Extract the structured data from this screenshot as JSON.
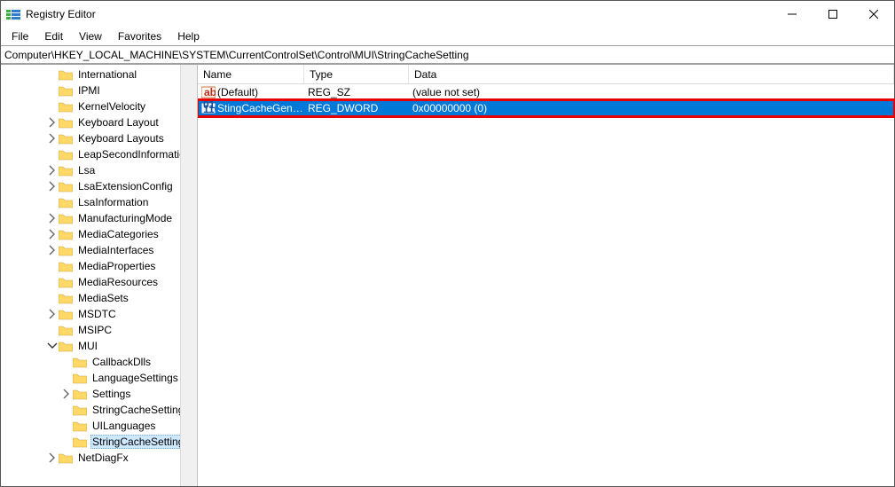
{
  "titlebar": {
    "title": "Registry Editor"
  },
  "menubar": {
    "file": "File",
    "edit": "Edit",
    "view": "View",
    "favorites": "Favorites",
    "help": "Help"
  },
  "addressbar": {
    "path": "Computer\\HKEY_LOCAL_MACHINE\\SYSTEM\\CurrentControlSet\\Control\\MUI\\StringCacheSetting"
  },
  "tree": {
    "items": [
      {
        "depth": 3,
        "twisty": "none",
        "label": "International"
      },
      {
        "depth": 3,
        "twisty": "none",
        "label": "IPMI"
      },
      {
        "depth": 3,
        "twisty": "none",
        "label": "KernelVelocity"
      },
      {
        "depth": 3,
        "twisty": "closed",
        "label": "Keyboard Layout"
      },
      {
        "depth": 3,
        "twisty": "closed",
        "label": "Keyboard Layouts"
      },
      {
        "depth": 3,
        "twisty": "none",
        "label": "LeapSecondInformation"
      },
      {
        "depth": 3,
        "twisty": "closed",
        "label": "Lsa"
      },
      {
        "depth": 3,
        "twisty": "closed",
        "label": "LsaExtensionConfig"
      },
      {
        "depth": 3,
        "twisty": "none",
        "label": "LsaInformation"
      },
      {
        "depth": 3,
        "twisty": "closed",
        "label": "ManufacturingMode"
      },
      {
        "depth": 3,
        "twisty": "closed",
        "label": "MediaCategories"
      },
      {
        "depth": 3,
        "twisty": "closed",
        "label": "MediaInterfaces"
      },
      {
        "depth": 3,
        "twisty": "none",
        "label": "MediaProperties"
      },
      {
        "depth": 3,
        "twisty": "none",
        "label": "MediaResources"
      },
      {
        "depth": 3,
        "twisty": "none",
        "label": "MediaSets"
      },
      {
        "depth": 3,
        "twisty": "closed",
        "label": "MSDTC"
      },
      {
        "depth": 3,
        "twisty": "none",
        "label": "MSIPC"
      },
      {
        "depth": 3,
        "twisty": "open",
        "label": "MUI"
      },
      {
        "depth": 4,
        "twisty": "none",
        "label": "CallbackDlls"
      },
      {
        "depth": 4,
        "twisty": "none",
        "label": "LanguageSettings"
      },
      {
        "depth": 4,
        "twisty": "closed",
        "label": "Settings"
      },
      {
        "depth": 4,
        "twisty": "none",
        "label": "StringCacheSettings"
      },
      {
        "depth": 4,
        "twisty": "none",
        "label": "UILanguages"
      },
      {
        "depth": 4,
        "twisty": "none",
        "label": "StringCacheSetting",
        "selected": true
      },
      {
        "depth": 3,
        "twisty": "closed",
        "label": "NetDiagFx"
      }
    ]
  },
  "list": {
    "columns": {
      "name": "Name",
      "type": "Type",
      "data": "Data"
    },
    "rows": [
      {
        "icon": "string",
        "name": "(Default)",
        "type": "REG_SZ",
        "data": "(value not set)",
        "selected": false,
        "highlight": false
      },
      {
        "icon": "dword",
        "name": "StingCacheGene...",
        "type": "REG_DWORD",
        "data": "0x00000000 (0)",
        "selected": true,
        "highlight": true
      }
    ]
  }
}
